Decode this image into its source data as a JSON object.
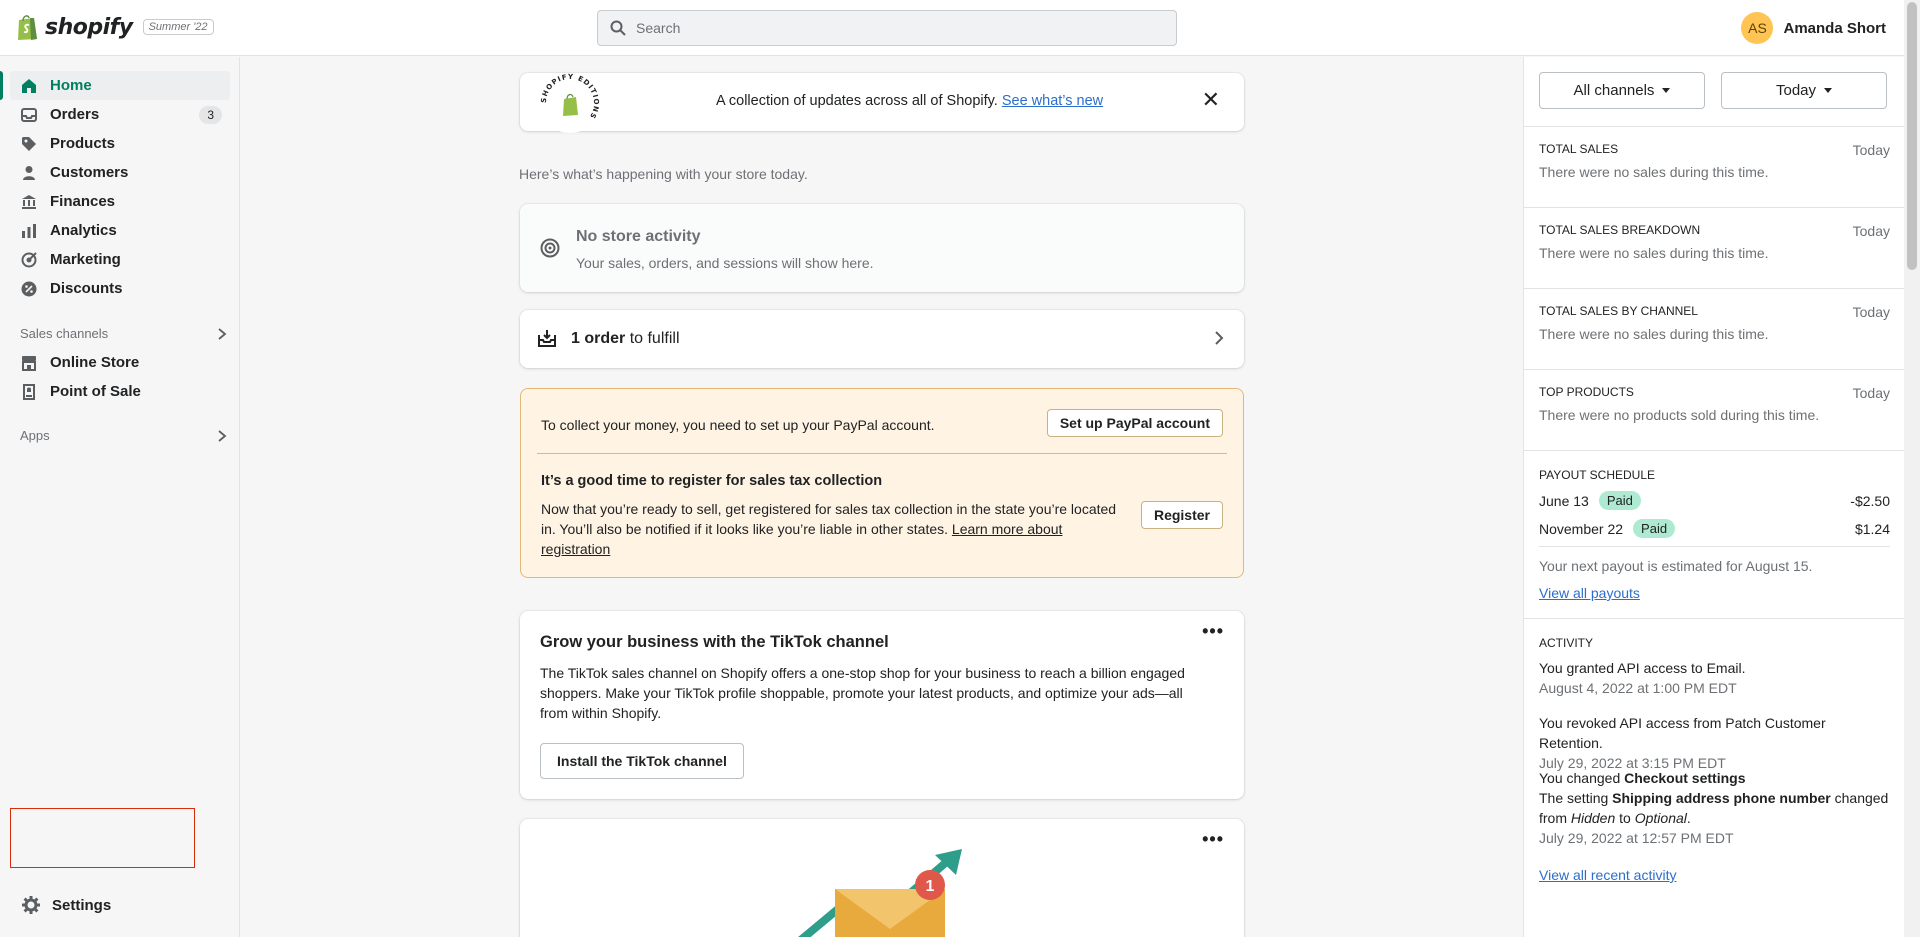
{
  "topbar": {
    "brand": "shopify",
    "edition": "Summer '22",
    "search_placeholder": "Search",
    "user_initials": "AS",
    "user_name": "Amanda Short"
  },
  "sidebar": {
    "items": [
      {
        "label": "Home",
        "icon": "home-icon"
      },
      {
        "label": "Orders",
        "icon": "orders-icon",
        "count": "3"
      },
      {
        "label": "Products",
        "icon": "tag-icon"
      },
      {
        "label": "Customers",
        "icon": "person-icon"
      },
      {
        "label": "Finances",
        "icon": "bank-icon"
      },
      {
        "label": "Analytics",
        "icon": "bar-chart-icon"
      },
      {
        "label": "Marketing",
        "icon": "target-icon"
      },
      {
        "label": "Discounts",
        "icon": "discount-icon"
      }
    ],
    "sales_channels_label": "Sales channels",
    "channels": [
      {
        "label": "Online Store",
        "icon": "store-icon"
      },
      {
        "label": "Point of Sale",
        "icon": "pos-icon"
      }
    ],
    "apps_label": "Apps",
    "settings_label": "Settings"
  },
  "main": {
    "editions_banner": {
      "text": "A collection of updates across all of Shopify.",
      "link": "See what’s new",
      "badge_text": "SHOPIFY EDITIONS"
    },
    "subtitle": "Here’s what’s happening with your store today.",
    "activity": {
      "title": "No store activity",
      "subtitle": "Your sales, orders, and sessions will show here."
    },
    "fulfill": {
      "bold": "1 order",
      "rest": " to fulfill"
    },
    "warning": {
      "paypal_text": "To collect your money, you need to set up your PayPal account.",
      "paypal_button": "Set up PayPal account",
      "tax_title": "It’s a good time to register for sales tax collection",
      "tax_body": "Now that you’re ready to sell, get registered for sales tax collection in the state you’re located in. You’ll also be notified if it looks like you’re liable in other states.",
      "tax_link": "Learn more about registration",
      "register_button": "Register"
    },
    "tiktok": {
      "title": "Grow your business with the TikTok channel",
      "body": "The TikTok sales channel on Shopify offers a one-stop shop for your business to reach a billion engaged shoppers. Make your TikTok profile shoppable, promote your latest products, and optimize your ads—all from within Shopify.",
      "button": "Install the TikTok channel",
      "more": "•••"
    },
    "promo": {
      "more": "•••",
      "notification_count": "1"
    }
  },
  "right_panel": {
    "channel_filter": "All channels",
    "date_filter": "Today",
    "sections": [
      {
        "title": "TOTAL SALES",
        "period": "Today",
        "body": "There were no sales during this time."
      },
      {
        "title": "TOTAL SALES BREAKDOWN",
        "period": "Today",
        "body": "There were no sales during this time."
      },
      {
        "title": "TOTAL SALES BY CHANNEL",
        "period": "Today",
        "body": "There were no sales during this time."
      },
      {
        "title": "TOP PRODUCTS",
        "period": "Today",
        "body": "There were no products sold during this time."
      }
    ],
    "payout": {
      "title": "PAYOUT SCHEDULE",
      "rows": [
        {
          "date": "June 13",
          "status": "Paid",
          "amount": "-$2.50"
        },
        {
          "date": "November 22",
          "status": "Paid",
          "amount": "$1.24"
        }
      ],
      "next": "Your next payout is estimated for August 15.",
      "link": "View all payouts"
    },
    "activity": {
      "title": "ACTIVITY",
      "items": [
        {
          "text": "You granted API access to Email.",
          "time": "August 4, 2022 at 1:00 PM EDT"
        },
        {
          "text": "You revoked API access from Patch Customer Retention.",
          "time": "July 29, 2022 at 3:15 PM EDT"
        }
      ],
      "changed_prefix": "You changed ",
      "changed_bold": "Checkout settings",
      "setting_prefix": "The setting ",
      "setting_bold": "Shipping address phone number",
      "setting_mid": " changed from ",
      "setting_from": "Hidden",
      "setting_to_word": " to ",
      "setting_to": "Optional",
      "setting_end": ".",
      "changed_time": "July 29, 2022 at 12:57 PM EDT",
      "link": "View all recent activity"
    }
  },
  "colors": {
    "accent_green": "#008060",
    "link_blue": "#2c6ecb",
    "warning_bg": "#fff4e4",
    "paid_badge": "#aee9d1",
    "avatar_bg": "#ffc453"
  }
}
